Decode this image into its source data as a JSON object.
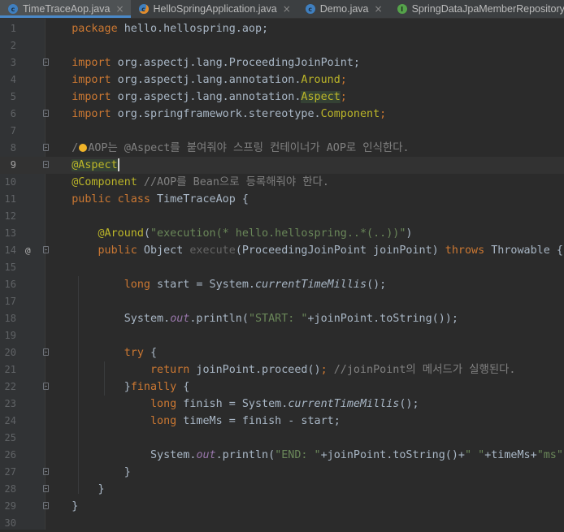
{
  "tabs": [
    {
      "label": "TimeTraceAop.java",
      "icon": "class-icon",
      "active": true
    },
    {
      "label": "HelloSpringApplication.java",
      "icon": "spring-boot-class-icon",
      "active": false
    },
    {
      "label": "Demo.java",
      "icon": "class-icon",
      "active": false
    },
    {
      "label": "SpringDataJpaMemberRepository.java",
      "icon": "interface-icon",
      "active": false
    }
  ],
  "close_glyph": "×",
  "gutter": {
    "numbers": [
      "1",
      "2",
      "3",
      "4",
      "5",
      "6",
      "7",
      "8",
      "9",
      "10",
      "11",
      "12",
      "13",
      "14",
      "15",
      "16",
      "17",
      "18",
      "19",
      "20",
      "21",
      "22",
      "23",
      "24",
      "25",
      "26",
      "27",
      "28",
      "29",
      "30"
    ],
    "override_mark": "@"
  },
  "code": {
    "l1": {
      "a": "package",
      "b": " hello.hellospring.aop;"
    },
    "l3": {
      "a": "import",
      "b": " org.aspectj.lang.ProceedingJoinPoint;"
    },
    "l4": {
      "a": "import",
      "b": " org.aspectj.lang.annotation.",
      "c": "Around",
      "d": ";"
    },
    "l5": {
      "a": "import",
      "b": " org.aspectj.lang.annotation.",
      "c": "Aspect",
      "d": ";"
    },
    "l6": {
      "a": "import",
      "b": " org.springframework.stereotype.",
      "c": "Component",
      "d": ";"
    },
    "l8": {
      "a": "/",
      "b": "AOP는 @Aspect를 붙여줘야 스프링 컨테이너가 AOP로 인식한다."
    },
    "l9": {
      "a": "@Aspect"
    },
    "l10": {
      "a": "@Component",
      "b": " //AOP를 Bean으로 등록해줘야 한다."
    },
    "l11": {
      "a": "public class",
      "b": " TimeTraceAop {"
    },
    "l13": {
      "a": "    @Around",
      "b": "(",
      "c": "\"execution(* hello.hellospring..*(..))\"",
      "d": ")"
    },
    "l14": {
      "a": "    public",
      "b": " Object ",
      "c": "execute",
      "d": "(ProceedingJoinPoint joinPoint) ",
      "e": "throws",
      "f": " Throwable {"
    },
    "l16": {
      "a": "        long",
      "b": " start = System.",
      "c": "currentTimeMillis",
      "d": "();"
    },
    "l18": {
      "a": "        System.",
      "b": "out",
      "c": ".println(",
      "d": "\"START: \"",
      "e": "+joinPoint.toString());"
    },
    "l20": {
      "a": "        try",
      "b": " {"
    },
    "l21": {
      "a": "            return",
      "b": " joinPoint.proceed()",
      "c": ";",
      "d": " //joinPoint의 메서드가 실행된다."
    },
    "l22": {
      "a": "        }",
      "b": "finally",
      "c": " {"
    },
    "l23": {
      "a": "            long",
      "b": " finish = System.",
      "c": "currentTimeMillis",
      "d": "();"
    },
    "l24": {
      "a": "            long",
      "b": " timeMs = finish - start;"
    },
    "l26": {
      "a": "            System.",
      "b": "out",
      "c": ".println(",
      "d": "\"END: \"",
      "e": "+joinPoint.toString()+",
      "f": "\" \"",
      "g": "+timeMs+",
      "h": "\"ms\"",
      "i": ");"
    },
    "l27": {
      "a": "        }"
    },
    "l28": {
      "a": "    }"
    },
    "l29": {
      "a": "}"
    }
  },
  "colors": {
    "background": "#2b2b2b",
    "keyword": "#cc7832",
    "annotation": "#bbb529",
    "string": "#6a8759",
    "comment": "#808080",
    "static_field": "#9876aa",
    "method_decl": "#ffc66d"
  }
}
